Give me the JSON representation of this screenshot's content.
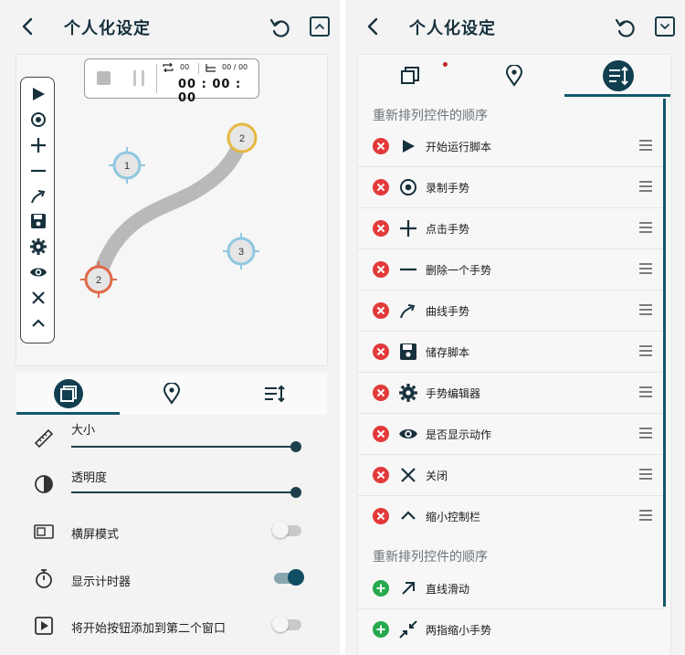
{
  "left_screen": {
    "title": "个人化设定",
    "timer": {
      "repeat_count": "00",
      "progress": "00 / 00",
      "clock": "00 : 00 : 00"
    },
    "markers": [
      "1",
      "2",
      "3",
      "2"
    ],
    "settings": {
      "size_label": "大小",
      "size_value": 1.0,
      "opacity_label": "透明度",
      "opacity_value": 1.0,
      "landscape_label": "横屏模式",
      "landscape_on": false,
      "show_timer_label": "显示计时器",
      "show_timer_on": true,
      "start_second_window_label": "将开始按钮添加到第二个窗口",
      "start_second_window_on": false
    }
  },
  "right_screen": {
    "title": "个人化设定",
    "section1_header": "重新排列控件的顺序",
    "section2_header": "重新排列控件的顺序",
    "items": [
      {
        "label": "开始运行脚本",
        "icon": "play-icon"
      },
      {
        "label": "录制手势",
        "icon": "record-icon"
      },
      {
        "label": "点击手势",
        "icon": "plus-icon"
      },
      {
        "label": "删除一个手势",
        "icon": "minus-icon"
      },
      {
        "label": "曲线手势",
        "icon": "curve-arrow-icon"
      },
      {
        "label": "储存脚本",
        "icon": "save-icon"
      },
      {
        "label": "手势编辑器",
        "icon": "gear-icon"
      },
      {
        "label": "是否显示动作",
        "icon": "eye-icon"
      },
      {
        "label": "关闭",
        "icon": "close-icon"
      },
      {
        "label": "缩小控制栏",
        "icon": "chevron-up-icon"
      }
    ],
    "available": [
      {
        "label": "直线滑动",
        "icon": "arrow-up-right-icon"
      },
      {
        "label": "两指缩小手势",
        "icon": "pinch-icon"
      }
    ]
  },
  "colors": {
    "accent": "#13566e",
    "remove": "#e23a3a",
    "add": "#27a94e",
    "marker_orange": "#e6b840",
    "marker_red": "#e06a4a",
    "marker_blue": "#8fc7e0"
  }
}
